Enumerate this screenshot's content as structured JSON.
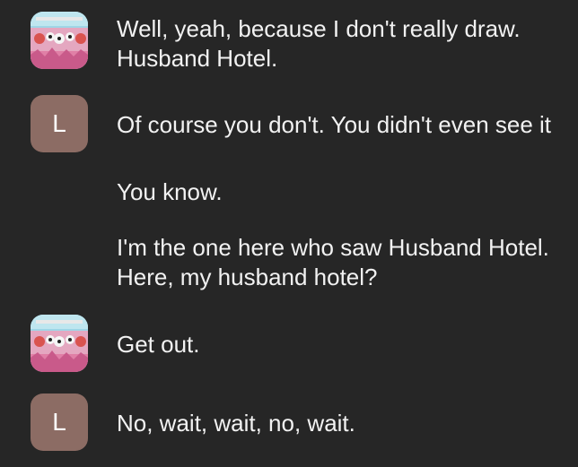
{
  "colors": {
    "background": "#262626",
    "text": "#f2f2f2",
    "letter_avatar_bg": "#8c6c64"
  },
  "messages": [
    {
      "sender": "image",
      "lines": [
        "Well, yeah, because I don't really draw.",
        "Husband Hotel."
      ]
    },
    {
      "sender": "L",
      "lines": [
        "Of course you don't. You didn't even see it"
      ]
    },
    {
      "sender": "L",
      "lines": [
        "You know."
      ]
    },
    {
      "sender": "L",
      "lines": [
        "I'm the one here who saw Husband Hotel.",
        "Here, my husband hotel?"
      ]
    },
    {
      "sender": "image",
      "lines": [
        "Get out."
      ]
    },
    {
      "sender": "L",
      "lines": [
        "No, wait, wait, no, wait."
      ]
    }
  ],
  "letter_avatar": {
    "initial": "L"
  }
}
